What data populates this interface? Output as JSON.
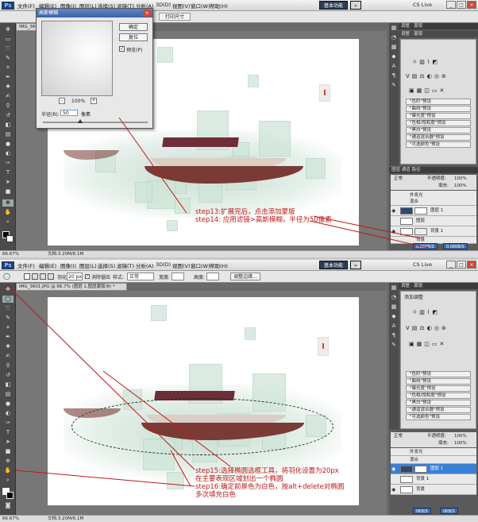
{
  "menu": [
    "文件(F)",
    "编辑(E)",
    "图像(I)",
    "图层(L)",
    "选择(S)",
    "滤镜(T)",
    "分析(A)",
    "3D(D)",
    "视图(V)",
    "窗口(W)",
    "帮助(H)"
  ],
  "workspace": {
    "button": "基本功能",
    "live": "CS Live"
  },
  "top": {
    "print_size": "打印尺寸",
    "doc_tab": "IMG_360",
    "dialog": {
      "title": "高斯模糊",
      "ok": "确定",
      "reset": "复位",
      "preview": "预览(P)",
      "zoom": "100%",
      "radius_label": "半径(R):",
      "radius_value": "50",
      "unit": "像素"
    },
    "zoom": "66.67%",
    "status_doc": "文档:3.20M/6.1M",
    "adjust_tab": "调整",
    "mask_tab": "蒙版",
    "presets": [
      "\"色阶\"预设",
      "\"曲线\"预设",
      "\"曝光度\"预设",
      "\"色相/饱和度\"预设",
      "\"黑白\"预设",
      "\"通道混合器\"预设",
      "\"可选颜色\"预设"
    ],
    "layers_tabs": [
      "图层",
      "通道",
      "路径"
    ],
    "blend": "正常",
    "opacity_label": "不透明度:",
    "opacity": "100%",
    "fill_label": "填充:",
    "fill": "100%",
    "layers": [
      {
        "name": "外发光",
        "sel": false
      },
      {
        "name": "混合",
        "sel": false
      },
      {
        "name": "图层 1",
        "sel": false
      },
      {
        "name": "图层",
        "sel": false
      },
      {
        "name": "背景 1",
        "sel": false
      },
      {
        "name": "背景",
        "sel": false
      }
    ],
    "net": {
      "up": "0.06KB/S",
      "down": "0.06KB/S"
    },
    "annotation": [
      "step13:扩展完后，点击添加蒙版",
      "step14: 应用滤镜>高斯模糊，半径为50像素"
    ]
  },
  "bottom": {
    "options": {
      "feather_label": "羽化:",
      "feather": "20 px",
      "antialias": "消除锯齿",
      "style_label": "样式:",
      "style": "正常",
      "width_label": "宽度:",
      "height_label": "高度:",
      "refine": "调整边缘..."
    },
    "doc_tab": "IMG_3601.JPG @ 66.7% (图层 1,图层蒙版/8) *",
    "zoom": "66.67%",
    "status_doc": "文档:3.20M/6.1M",
    "adjust_tab": "调整",
    "mask_tab": "蒙版",
    "adjust_title": "添加调整",
    "presets": [
      "\"色阶\"预设",
      "\"曲线\"预设",
      "\"曝光度\"预设",
      "\"色相/饱和度\"预设",
      "\"黑白\"预设",
      "\"通道混合器\"预设",
      "\"可选颜色\"预设"
    ],
    "blend": "正常",
    "opacity_label": "不透明度:",
    "opacity": "100%",
    "fill_label": "填充:",
    "fill": "100%",
    "layers": [
      {
        "name": "外发光",
        "sel": false
      },
      {
        "name": "混合",
        "sel": false
      },
      {
        "name": "图层 1",
        "sel": true
      },
      {
        "name": "背景 1",
        "sel": false
      },
      {
        "name": "背景",
        "sel": false
      }
    ],
    "net": {
      "up": "0KB/S",
      "down": "0KB/S"
    },
    "annotation": [
      "step15:选择椭圆选框工具，将羽化设置为20px",
      "在主要表现区域划出一个椭圆",
      "step16:确定前景色为白色，按alt+delete对椭圆",
      "多次填充白色"
    ]
  },
  "colors": {
    "annotation": "#c01818",
    "accent": "#3a7fd6",
    "titlebar": "#3b63a6"
  }
}
